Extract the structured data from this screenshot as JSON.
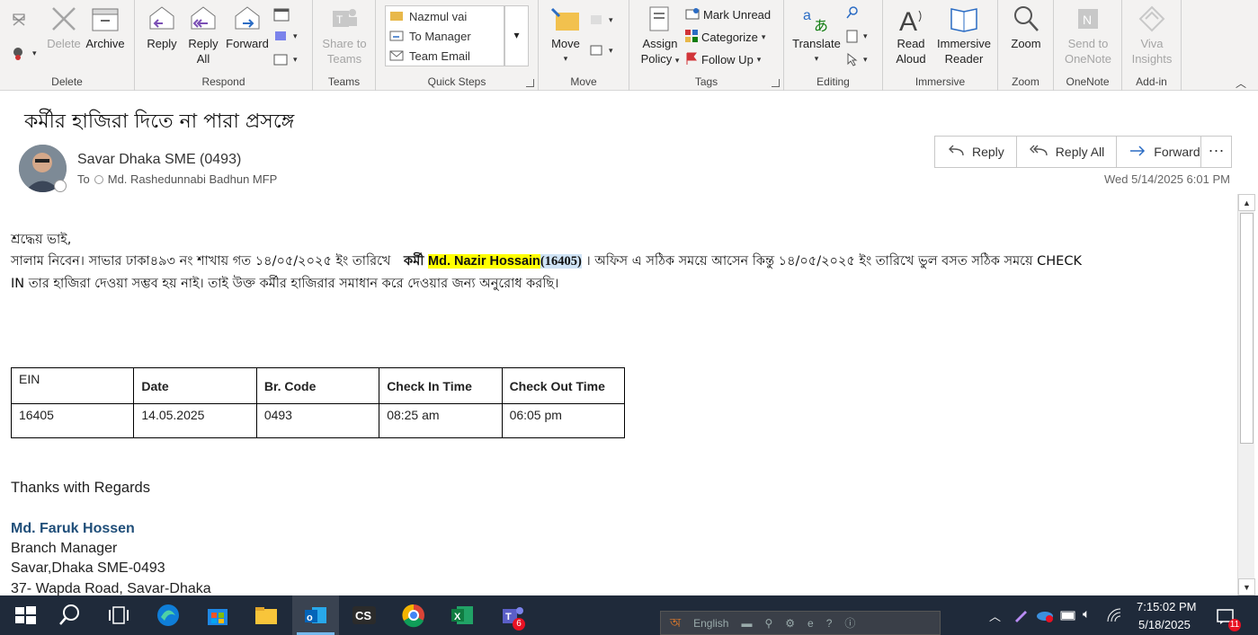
{
  "ribbon": {
    "delete_group": {
      "label": "Delete",
      "delete": "Delete",
      "archive": "Archive"
    },
    "respond_group": {
      "label": "Respond",
      "reply": "Reply",
      "reply_all_1": "Reply",
      "reply_all_2": "All",
      "forward": "Forward"
    },
    "teams_group": {
      "label": "Teams",
      "share1": "Share to",
      "share2": "Teams"
    },
    "quick_steps": {
      "label": "Quick Steps",
      "items": [
        "Nazmul vai",
        "To Manager",
        "Team Email"
      ]
    },
    "move_group": {
      "label": "Move",
      "move": "Move"
    },
    "tags_group": {
      "label": "Tags",
      "assign1": "Assign",
      "assign2": "Policy",
      "mark_unread": "Mark Unread",
      "categorize": "Categorize",
      "follow_up": "Follow Up"
    },
    "editing_group": {
      "label": "Editing",
      "translate": "Translate"
    },
    "immersive_group": {
      "label": "Immersive",
      "read1": "Read",
      "read2": "Aloud",
      "imm1": "Immersive",
      "imm2": "Reader"
    },
    "zoom_group": {
      "label": "Zoom",
      "zoom": "Zoom"
    },
    "onenote_group": {
      "label": "OneNote",
      "send1": "Send to",
      "send2": "OneNote"
    },
    "addin_group": {
      "label": "Add-in",
      "viva1": "Viva",
      "viva2": "Insights"
    }
  },
  "message": {
    "subject": "কর্মীর হাজিরা দিতে না পারা প্রসঙ্গে",
    "sender": "Savar Dhaka SME (0493)",
    "to_label": "To",
    "recipient": "Md. Rashedunnabi Badhun MFP",
    "date": "Wed 5/14/2025 6:01 PM",
    "actions": {
      "reply": "Reply",
      "reply_all": "Reply All",
      "forward": "Forward"
    }
  },
  "body": {
    "greeting": "শ্রদ্ধেয় ভাই,",
    "line1_pre": "সালাম নিবেন। সাভার ঢাকা৪৯৩ নং শাখায় গত ১৪/০৫/২০২৫ ইং তারিখে",
    "line1_bold": "কর্মী",
    "line1_name": "Md. Nazir Hossain",
    "line1_ein": "(16405)",
    "line1_post": "। অফিস এ সঠিক সময়ে আসেন কিন্তু ১৪/০৫/২০২৫ ইং তারিখে ভুল বসত  সঠিক সময়ে CHECK",
    "line2": "IN  তার হাজিরা দেওয়া সম্ভব হয় নাই।  তাই উক্ত কর্মীর হাজিরার সমাধান করে দেওয়ার জন্য অনুরোধ করছি।",
    "table": {
      "headers": [
        "EIN",
        "Date",
        "Br. Code",
        "Check In Time",
        "Check Out Time"
      ],
      "row": [
        "16405",
        "14.05.2025",
        "0493",
        "08:25 am",
        "06:05 pm"
      ]
    },
    "closing": "Thanks with Regards",
    "sig_name": "Md. Faruk Hossen",
    "sig_title": "Branch Manager",
    "sig_branch": "Savar,Dhaka SME-0493",
    "sig_address": "37- Wapda Road, Savar-Dhaka"
  },
  "taskbar": {
    "lang": "English",
    "time": "7:15:02 PM",
    "date": "5/18/2025",
    "teams_badge": "6",
    "notif_badge": "11",
    "cs_label": "CS"
  }
}
